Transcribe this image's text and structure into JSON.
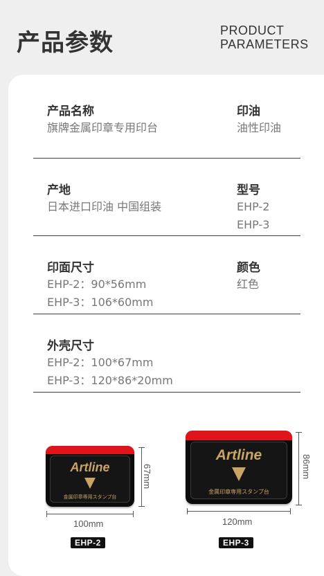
{
  "header": {
    "title_cn": "产品参数",
    "title_en_line1": "PRODUCT",
    "title_en_line2": "PARAMETERS"
  },
  "params": [
    {
      "left_label": "产品名称",
      "left_values": [
        "旗牌金属印章专用印台"
      ],
      "right_label": "印油",
      "right_values": [
        "油性印油"
      ]
    },
    {
      "left_label": "产地",
      "left_values": [
        "日本进口印油 中国组装"
      ],
      "right_label": "型号",
      "right_values": [
        "EHP-2",
        "EHP-3"
      ]
    },
    {
      "left_label": "印面尺寸",
      "left_values": [
        "EHP-2：90*56mm",
        "EHP-3：106*60mm"
      ],
      "right_label": "颜色",
      "right_values": [
        "红色"
      ]
    },
    {
      "left_label": "外壳尺寸",
      "left_values": [
        "EHP-2：100*67mm",
        "EHP-3：120*86*20mm"
      ]
    }
  ],
  "products": [
    {
      "brand": "Artline",
      "caption": "金属印章専用スタンプ台",
      "width_label": "100mm",
      "height_label": "67mm",
      "model_tag": "EHP-2"
    },
    {
      "brand": "Artline",
      "caption": "金属印章専用スタンプ台",
      "width_label": "120mm",
      "height_label": "86mm",
      "model_tag": "EHP-3"
    }
  ],
  "colors": {
    "background": "#efefef",
    "card": "#ffffff",
    "pad_body": "#0c0c0c",
    "pad_rim": "#e0141b",
    "brand_gold": "#c9a465"
  }
}
